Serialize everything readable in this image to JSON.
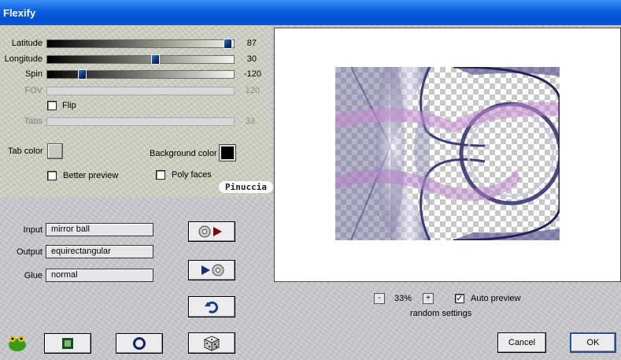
{
  "window": {
    "title": "Flexify"
  },
  "sliders": [
    {
      "label": "Latitude",
      "value": "87",
      "fraction": 0.99,
      "enabled": true
    },
    {
      "label": "Longitude",
      "value": "30",
      "fraction": 0.58,
      "enabled": true
    },
    {
      "label": "Spin",
      "value": "-120",
      "fraction": 0.17,
      "enabled": true
    },
    {
      "label": "FOV",
      "value": "120",
      "fraction": 0.0,
      "enabled": false
    },
    {
      "label": "Tabs",
      "value": "33",
      "fraction": 0.0,
      "enabled": false
    }
  ],
  "options": {
    "flip": {
      "label": "Flip",
      "checked": false
    },
    "tab_color": {
      "label": "Tab color",
      "color": "#c8c9c0"
    },
    "background_color": {
      "label": "Background color",
      "color": "#000000"
    },
    "better_preview": {
      "label": "Better preview",
      "checked": false
    },
    "poly_faces": {
      "label": "Poly faces",
      "checked": false
    }
  },
  "watermark": "Pinuccia",
  "projection": {
    "input": {
      "label": "Input",
      "value": "mirror ball"
    },
    "output": {
      "label": "Output",
      "value": "equirectangular"
    },
    "glue": {
      "label": "Glue",
      "value": "normal"
    }
  },
  "preview": {
    "zoom": "33%",
    "zoom_out_label": "-",
    "zoom_in_label": "+",
    "auto_preview": {
      "label": "Auto preview",
      "checked": true,
      "mark": "✓"
    },
    "random_settings": "random settings"
  },
  "buttons": {
    "cancel": "Cancel",
    "ok": "OK"
  },
  "colors": {
    "title_bar": "#0a5ee0",
    "slider_thumb": "#0e2f6e",
    "panel": "#cfd0c3"
  }
}
